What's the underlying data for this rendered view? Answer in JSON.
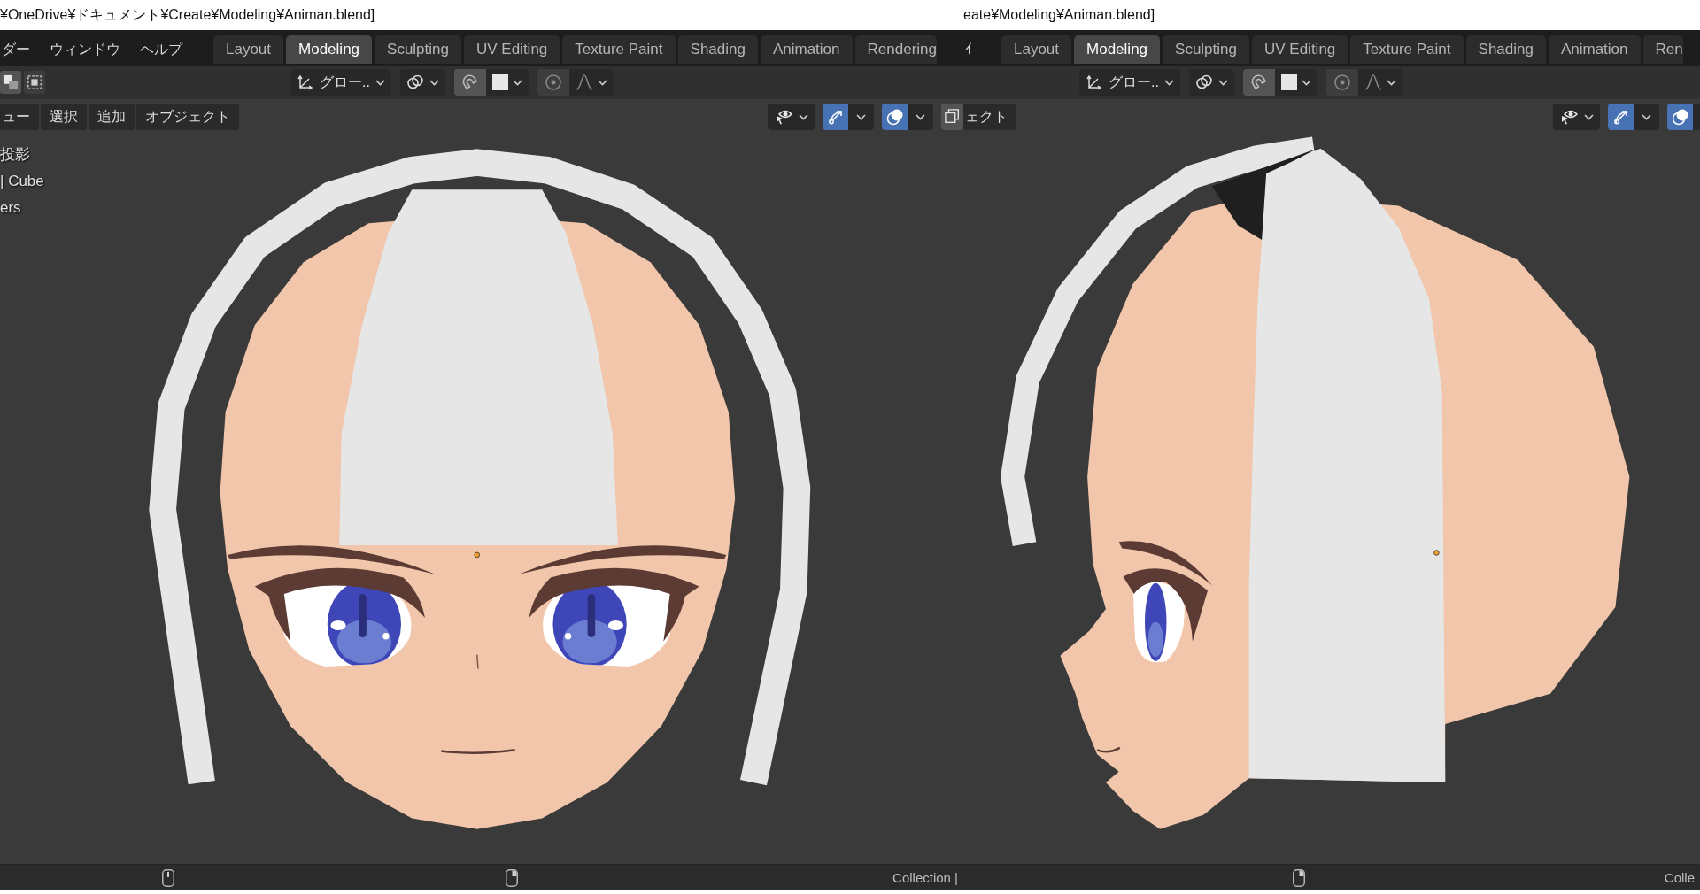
{
  "windows": [
    {
      "title": "¥OneDrive¥ドキュメント¥Create¥Modeling¥Animan.blend]",
      "menus": [
        "ダー",
        "ウィンドウ",
        "ヘルプ"
      ],
      "workspace_tabs": [
        {
          "label": "Layout",
          "selected": false
        },
        {
          "label": "Modeling",
          "selected": true
        },
        {
          "label": "Sculpting",
          "selected": false
        },
        {
          "label": "UV Editing",
          "selected": false
        },
        {
          "label": "Texture Paint",
          "selected": false
        },
        {
          "label": "Shading",
          "selected": false
        },
        {
          "label": "Animation",
          "selected": false
        },
        {
          "label": "Rendering",
          "selected": false
        }
      ],
      "tool_header": [
        {
          "kind": "select_mode",
          "options": [
            {
              "selected": true
            },
            {
              "selected": false
            }
          ]
        },
        {
          "kind": "orientation",
          "value": "グロー.."
        },
        {
          "kind": "pivot"
        },
        {
          "kind": "snap"
        },
        {
          "kind": "proportional"
        }
      ],
      "viewport_header": {
        "menus": [
          "ュー",
          "選択",
          "追加",
          "オブジェクト"
        ],
        "tools": [
          {
            "kind": "visibility"
          },
          {
            "kind": "gizmos",
            "on": true
          },
          {
            "kind": "overlays",
            "on": true
          },
          {
            "kind": "xray"
          }
        ]
      },
      "viewport_info": [
        "投影",
        "| Cube",
        "ers"
      ],
      "status_bar": {
        "hints": [
          {
            "kind": "mouse_middle"
          },
          {
            "kind": "mouse_right"
          }
        ],
        "text": "Collection |"
      }
    },
    {
      "title": "eate¥Modeling¥Animan.blend]",
      "menus": [
        "ｲ"
      ],
      "workspace_tabs": [
        {
          "label": "Layout",
          "selected": false
        },
        {
          "label": "Modeling",
          "selected": true
        },
        {
          "label": "Sculpting",
          "selected": false
        },
        {
          "label": "UV Editing",
          "selected": false
        },
        {
          "label": "Texture Paint",
          "selected": false
        },
        {
          "label": "Shading",
          "selected": false
        },
        {
          "label": "Animation",
          "selected": false
        },
        {
          "label": "Ren",
          "selected": false
        }
      ],
      "tool_header": [
        {
          "kind": "orientation",
          "value": "グロー.."
        },
        {
          "kind": "pivot"
        },
        {
          "kind": "snap"
        },
        {
          "kind": "proportional"
        }
      ],
      "viewport_header": {
        "menus": [
          "ェクト"
        ],
        "tools": [
          {
            "kind": "visibility"
          },
          {
            "kind": "gizmos",
            "on": true
          },
          {
            "kind": "overlays",
            "on": true
          }
        ]
      },
      "status_bar": {
        "hints": [
          {
            "kind": "mouse_right"
          }
        ],
        "text": "Colle"
      }
    }
  ]
}
